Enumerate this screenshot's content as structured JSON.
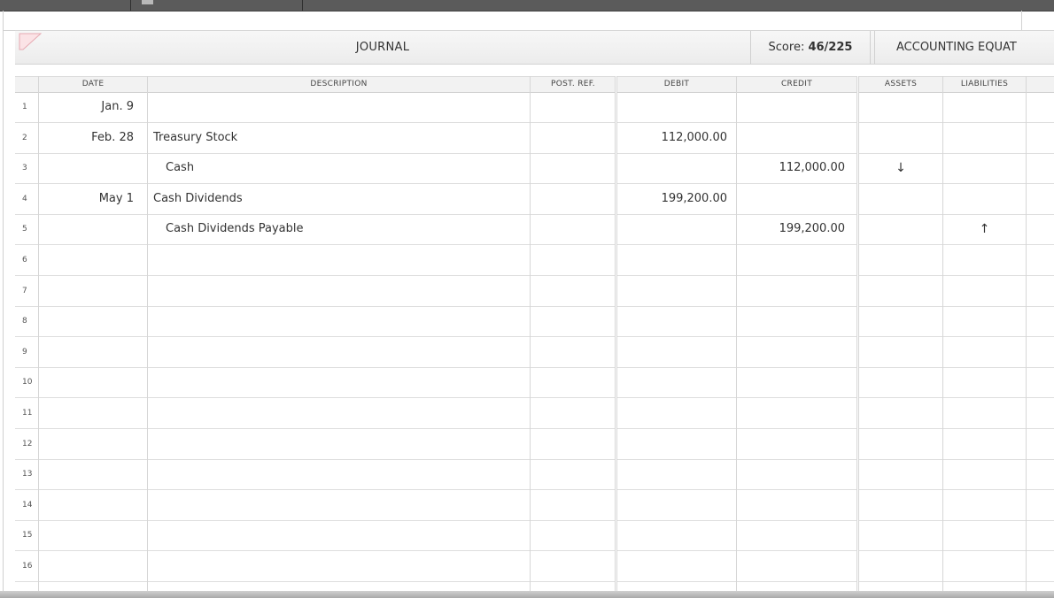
{
  "header": {
    "journal_title": "JOURNAL",
    "score_label": "Score: ",
    "score_value": "46/225",
    "accounting_equation_label": "ACCOUNTING EQUAT"
  },
  "columns": {
    "date": "DATE",
    "description": "DESCRIPTION",
    "post_ref": "POST. REF.",
    "debit": "DEBIT",
    "credit": "CREDIT",
    "assets": "ASSETS",
    "liabilities": "LIABILITIES"
  },
  "rows": [
    {
      "num": "1",
      "date": "Jan. 9",
      "description": "",
      "post_ref": "",
      "debit": "",
      "credit": "",
      "assets": "",
      "liabilities": "",
      "indent": false
    },
    {
      "num": "2",
      "date": "Feb. 28",
      "description": "Treasury Stock",
      "post_ref": "",
      "debit": "112,000.00",
      "credit": "",
      "assets": "",
      "liabilities": "",
      "indent": false
    },
    {
      "num": "3",
      "date": "",
      "description": "Cash",
      "post_ref": "",
      "debit": "",
      "credit": "112,000.00",
      "assets": "↓",
      "liabilities": "",
      "indent": true
    },
    {
      "num": "4",
      "date": "May 1",
      "description": "Cash Dividends",
      "post_ref": "",
      "debit": "199,200.00",
      "credit": "",
      "assets": "",
      "liabilities": "",
      "indent": false
    },
    {
      "num": "5",
      "date": "",
      "description": "Cash Dividends Payable",
      "post_ref": "",
      "debit": "",
      "credit": "199,200.00",
      "assets": "",
      "liabilities": "↑",
      "indent": true
    },
    {
      "num": "6",
      "date": "",
      "description": "",
      "post_ref": "",
      "debit": "",
      "credit": "",
      "assets": "",
      "liabilities": "",
      "indent": false
    },
    {
      "num": "7",
      "date": "",
      "description": "",
      "post_ref": "",
      "debit": "",
      "credit": "",
      "assets": "",
      "liabilities": "",
      "indent": false
    },
    {
      "num": "8",
      "date": "",
      "description": "",
      "post_ref": "",
      "debit": "",
      "credit": "",
      "assets": "",
      "liabilities": "",
      "indent": false
    },
    {
      "num": "9",
      "date": "",
      "description": "",
      "post_ref": "",
      "debit": "",
      "credit": "",
      "assets": "",
      "liabilities": "",
      "indent": false
    },
    {
      "num": "10",
      "date": "",
      "description": "",
      "post_ref": "",
      "debit": "",
      "credit": "",
      "assets": "",
      "liabilities": "",
      "indent": false
    },
    {
      "num": "11",
      "date": "",
      "description": "",
      "post_ref": "",
      "debit": "",
      "credit": "",
      "assets": "",
      "liabilities": "",
      "indent": false
    },
    {
      "num": "12",
      "date": "",
      "description": "",
      "post_ref": "",
      "debit": "",
      "credit": "",
      "assets": "",
      "liabilities": "",
      "indent": false
    },
    {
      "num": "13",
      "date": "",
      "description": "",
      "post_ref": "",
      "debit": "",
      "credit": "",
      "assets": "",
      "liabilities": "",
      "indent": false
    },
    {
      "num": "14",
      "date": "",
      "description": "",
      "post_ref": "",
      "debit": "",
      "credit": "",
      "assets": "",
      "liabilities": "",
      "indent": false
    },
    {
      "num": "15",
      "date": "",
      "description": "",
      "post_ref": "",
      "debit": "",
      "credit": "",
      "assets": "",
      "liabilities": "",
      "indent": false
    },
    {
      "num": "16",
      "date": "",
      "description": "",
      "post_ref": "",
      "debit": "",
      "credit": "",
      "assets": "",
      "liabilities": "",
      "indent": false
    }
  ]
}
